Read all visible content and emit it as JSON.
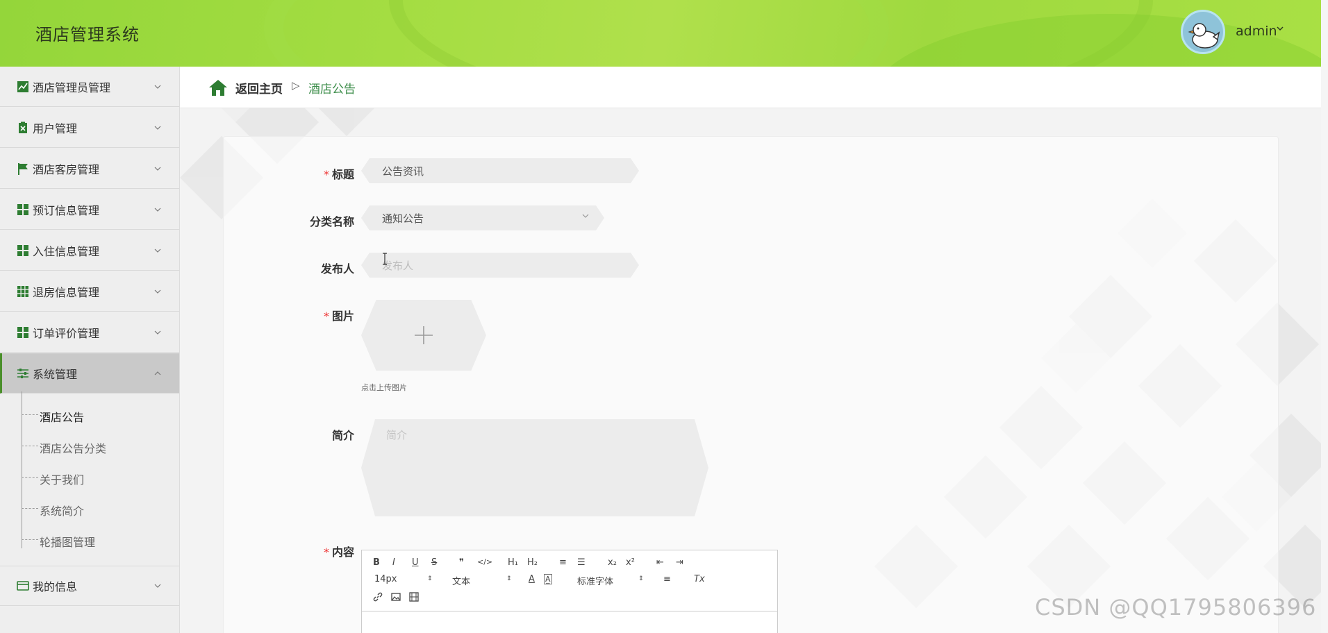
{
  "app": {
    "title": "酒店管理系统"
  },
  "user": {
    "name": "admin"
  },
  "sidebar": {
    "items": [
      {
        "label": "酒店管理员管理"
      },
      {
        "label": "用户管理"
      },
      {
        "label": "酒店客房管理"
      },
      {
        "label": "预订信息管理"
      },
      {
        "label": "入住信息管理"
      },
      {
        "label": "退房信息管理"
      },
      {
        "label": "订单评价管理"
      },
      {
        "label": "系统管理"
      },
      {
        "label": "我的信息"
      }
    ],
    "submenu": [
      {
        "label": "酒店公告"
      },
      {
        "label": "酒店公告分类"
      },
      {
        "label": "关于我们"
      },
      {
        "label": "系统简介"
      },
      {
        "label": "轮播图管理"
      }
    ]
  },
  "breadcrumb": {
    "home": "返回主页",
    "separator": "▷",
    "current": "酒店公告"
  },
  "form": {
    "title": {
      "label": "标题",
      "value": "公告资讯",
      "required": "*"
    },
    "category": {
      "label": "分类名称",
      "value": "通知公告"
    },
    "publisher": {
      "label": "发布人",
      "placeholder": "发布人"
    },
    "image": {
      "label": "图片",
      "required": "*",
      "hint": "点击上传图片"
    },
    "summary": {
      "label": "简介",
      "placeholder": "简介"
    },
    "content": {
      "label": "内容",
      "required": "*"
    }
  },
  "editor": {
    "font_size": "14px",
    "text_type": "文本",
    "font_family": "标准字体",
    "buttons_row1": [
      "B",
      "I",
      "U",
      "S",
      "❞",
      "</>",
      "H₁",
      "H₂",
      "≡",
      "☰",
      "x₂",
      "x²",
      "⇤",
      "⇥"
    ],
    "buttons_row2": [
      "A",
      "A̲",
      "≡",
      "Tx"
    ]
  },
  "watermark": "CSDN @QQ1795806396",
  "colors": {
    "header": "#a4dd42",
    "accent": "#3c8d4a",
    "required": "#e33333"
  }
}
